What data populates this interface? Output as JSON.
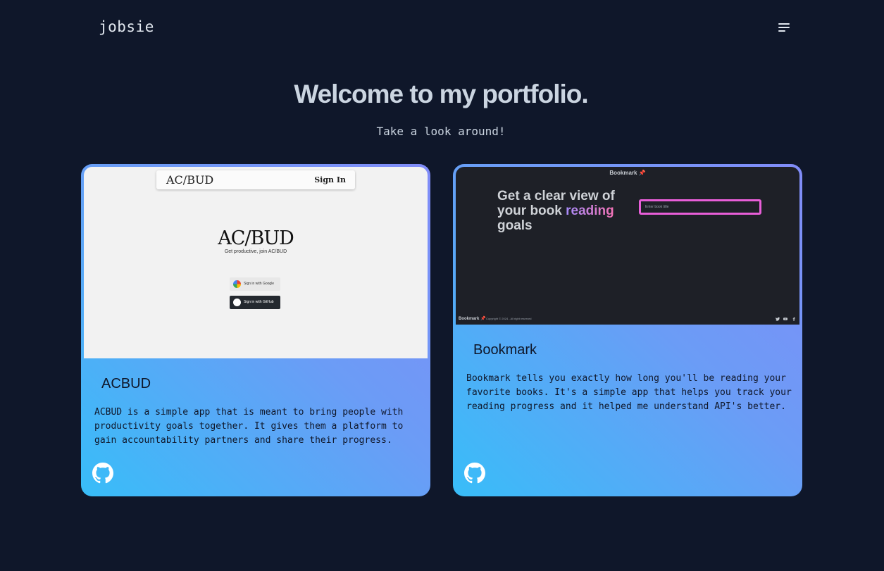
{
  "header": {
    "brand": "jobsie",
    "menu_icon": "menu-icon"
  },
  "hero": {
    "title": "Welcome to my portfolio.",
    "subtitle": "Take a look around!"
  },
  "projects": [
    {
      "title": "ACBUD",
      "description": "ACBUD is a simple app that is meant to bring people with productivity goals together. It gives them a platform to gain accountability partners and share their progress.",
      "link_icon": "github-icon",
      "preview": {
        "nav_logo": "AC/BUD",
        "nav_signin": "Sign In",
        "logo": "AC/BUD",
        "tagline": "Get productive, join AC/BUD",
        "google_button": "Sign in with Google",
        "github_button": "Sign in with GitHub"
      }
    },
    {
      "title": "Bookmark",
      "description": "Bookmark tells you exactly how long you'll be reading your favorite books. It's a simple app that helps you track your reading progress and it helped me understand API's better.",
      "link_icon": "github-icon",
      "preview": {
        "top_title": "Bookmark 📌",
        "headline_part1": "Get a clear view of your book ",
        "headline_accent": "reading",
        "headline_part2": " goals",
        "input_placeholder": "Enter book title",
        "footer_brand": "Bookmark 📌",
        "footer_copy": "Copyright © 2024 - All right reserved"
      }
    }
  ],
  "colors": {
    "background": "#0f172a",
    "card_gradient_start": "#38bdf8",
    "card_gradient_end": "#818cf8",
    "accent_pink": "#e85ed8"
  }
}
